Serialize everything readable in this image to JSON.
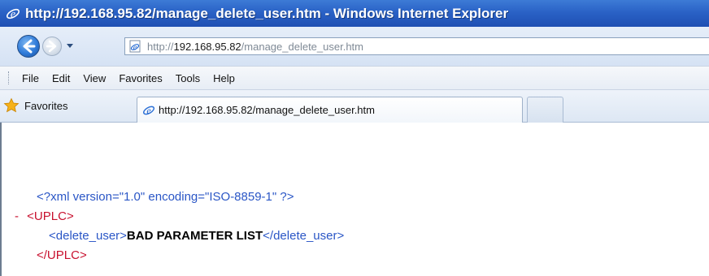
{
  "window": {
    "title": "http://192.168.95.82/manage_delete_user.htm - Windows Internet Explorer"
  },
  "address_bar": {
    "scheme": "http://",
    "host": "192.168.95.82",
    "path": "/manage_delete_user.htm"
  },
  "menu": {
    "items": [
      "File",
      "Edit",
      "View",
      "Favorites",
      "Tools",
      "Help"
    ]
  },
  "favorites_bar": {
    "favorites_label": "Favorites",
    "active_tab_label": "http://192.168.95.82/manage_delete_user.htm"
  },
  "xml": {
    "declaration": "<?xml version=\"1.0\" encoding=\"ISO-8859-1\" ?>",
    "collapse_marker": "-",
    "root_open": "<UPLC>",
    "child_open": "<delete_user>",
    "child_value": "BAD PARAMETER LIST",
    "child_close": "</delete_user>",
    "root_close": "</UPLC>"
  },
  "colors": {
    "titlebar": "#2a62c6",
    "xml_markup": "#2a56c6",
    "xml_tag_name": "#c8102e"
  },
  "icons": [
    "ie-icon",
    "back-arrow-icon",
    "forward-arrow-icon",
    "dropdown-arrow-icon",
    "page-icon",
    "favorites-star-icon"
  ]
}
